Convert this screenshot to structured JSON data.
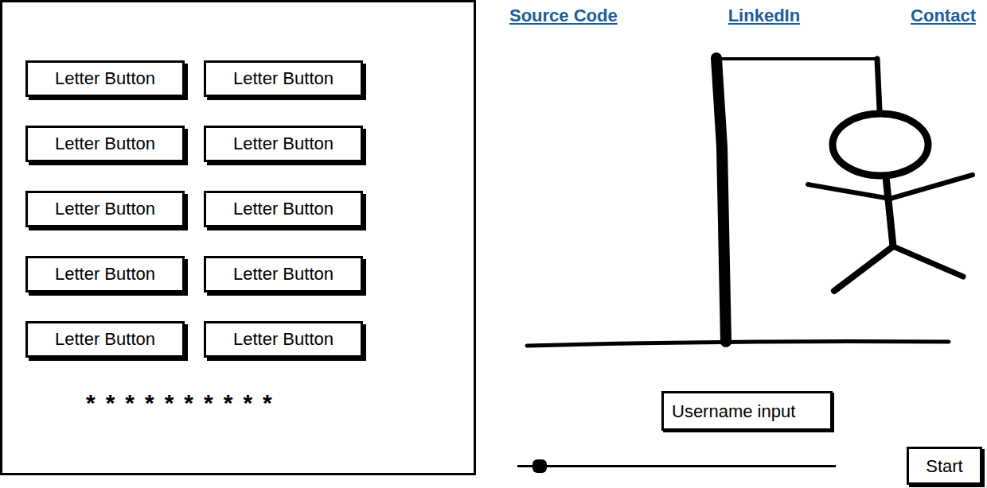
{
  "letter_buttons": [
    {
      "label": "Letter Button"
    },
    {
      "label": "Letter Button"
    },
    {
      "label": "Letter Button"
    },
    {
      "label": "Letter Button"
    },
    {
      "label": "Letter Button"
    },
    {
      "label": "Letter Button"
    },
    {
      "label": "Letter Button"
    },
    {
      "label": "Letter Button"
    },
    {
      "label": "Letter Button"
    },
    {
      "label": "Letter Button"
    }
  ],
  "hidden_word": "**********",
  "links": [
    "Source Code",
    "LinkedIn",
    "Contact"
  ],
  "hangman": {
    "stage": 6
  },
  "username": {
    "placeholder": "Username input"
  },
  "slider": {
    "level": 0.07
  },
  "buttons": [
    "Start"
  ]
}
